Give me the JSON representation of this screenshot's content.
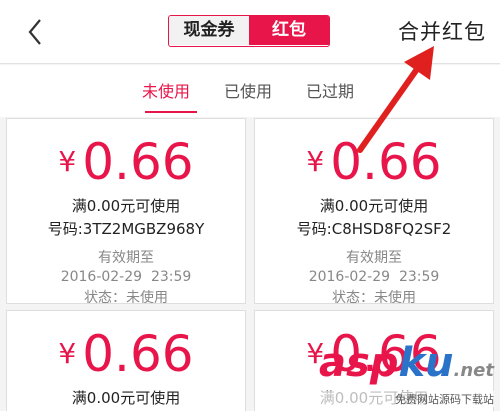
{
  "header": {
    "segments": [
      {
        "label": "现金券",
        "active": false
      },
      {
        "label": "红包",
        "active": true
      }
    ],
    "merge_label": "合并红包"
  },
  "subtabs": [
    {
      "label": "未使用",
      "active": true
    },
    {
      "label": "已使用",
      "active": false
    },
    {
      "label": "已过期",
      "active": false
    }
  ],
  "cards": [
    {
      "currency": "¥",
      "amount": "0.66",
      "condition": "满0.00元可使用",
      "code": "号码:3TZ2MGBZ968Y",
      "valid_label": "有效期至",
      "valid_until": "2016-02-29  23:59",
      "status": "状态：未使用"
    },
    {
      "currency": "¥",
      "amount": "0.66",
      "condition": "满0.00元可使用",
      "code": "号码:C8HSD8FQ2SF2",
      "valid_label": "有效期至",
      "valid_until": "2016-02-29  23:59",
      "status": "状态：未使用"
    },
    {
      "currency": "¥",
      "amount": "0.66",
      "condition": "满0.00元可使用",
      "code": "",
      "valid_label": "",
      "valid_until": "",
      "status": ""
    },
    {
      "currency": "¥",
      "amount": "0.66",
      "condition": "满0.00元可使用",
      "code": "",
      "valid_label": "",
      "valid_until": "",
      "status": ""
    }
  ],
  "watermark": {
    "logo_a": "asp",
    "logo_b": "ku",
    "logo_c": ".net",
    "sub": "免费网站源码下载站"
  },
  "colors": {
    "accent": "#e8154a",
    "link": "#2a73c9"
  },
  "icons": {
    "back": "chevron-left-icon",
    "annotation": "red-arrow-icon"
  }
}
